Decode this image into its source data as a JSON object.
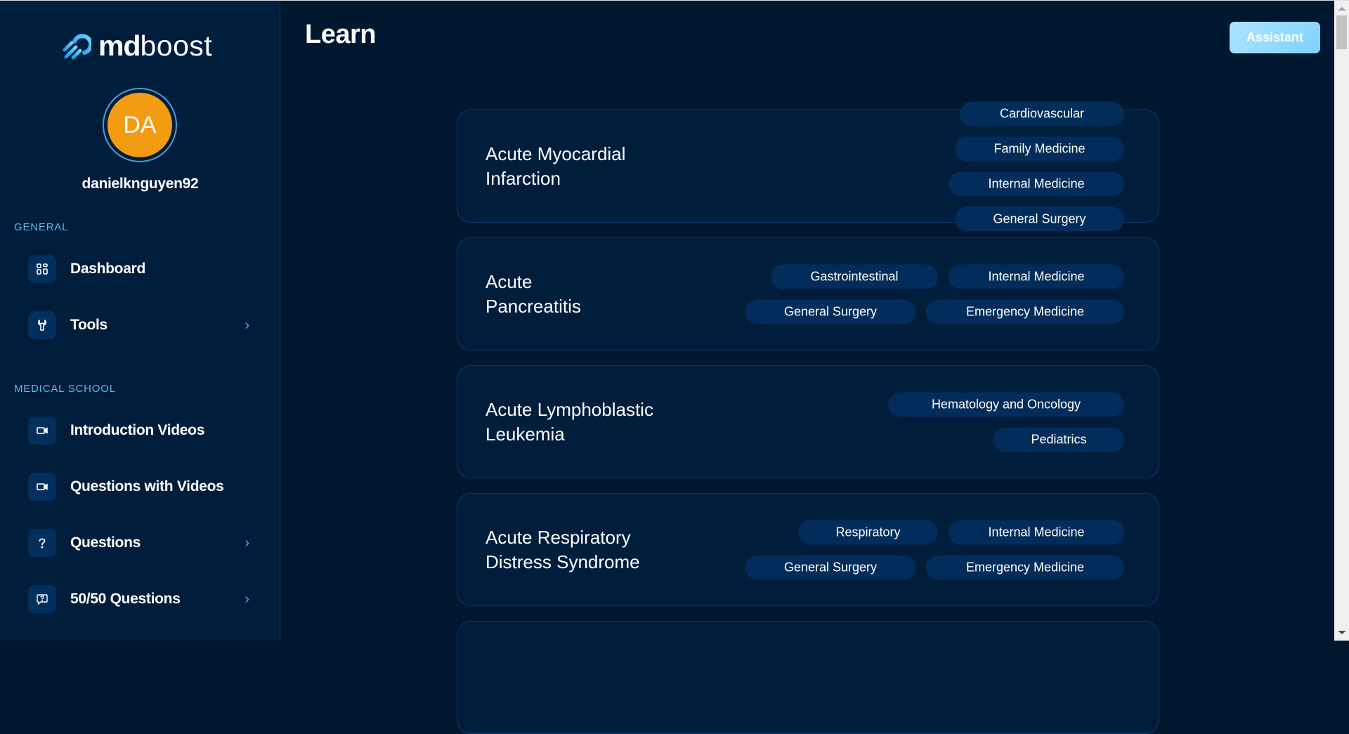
{
  "brand": {
    "name_bold": "md",
    "name_light": "boost"
  },
  "user": {
    "initials": "DA",
    "username": "danielknguyen92",
    "avatar_color": "#f39c12"
  },
  "sidebar": {
    "sections": [
      {
        "label": "GENERAL",
        "items": [
          {
            "label": "Dashboard",
            "icon": "dashboard-grid-icon",
            "has_chevron": false
          },
          {
            "label": "Tools",
            "icon": "wrench-icon",
            "has_chevron": true
          }
        ]
      },
      {
        "label": "MEDICAL SCHOOL",
        "items": [
          {
            "label": "Introduction Videos",
            "icon": "video-camera-icon",
            "has_chevron": false
          },
          {
            "label": "Questions with Videos",
            "icon": "video-camera-icon",
            "has_chevron": false
          },
          {
            "label": "Questions",
            "icon": "question-mark-icon",
            "has_chevron": true
          },
          {
            "label": "50/50 Questions",
            "icon": "question-chat-icon",
            "has_chevron": true
          }
        ]
      }
    ],
    "chevron_glyph": "›"
  },
  "header": {
    "title": "Learn",
    "assistant_label": "Assistant"
  },
  "topics": [
    {
      "title": "Acute Myocardial Infarction",
      "tags": [
        "Cardiovascular",
        "Family Medicine",
        "Internal Medicine",
        "General Surgery"
      ]
    },
    {
      "title": "Acute Pancreatitis",
      "tags": [
        "Gastrointestinal",
        "Internal Medicine",
        "General Surgery",
        "Emergency Medicine"
      ]
    },
    {
      "title": "Acute Lymphoblastic Leukemia",
      "tags": [
        "Hematology and Oncology",
        "Pediatrics"
      ]
    },
    {
      "title": "Acute Respiratory Distress Syndrome",
      "tags": [
        "Respiratory",
        "Internal Medicine",
        "General Surgery",
        "Emergency Medicine"
      ]
    },
    {
      "title": "",
      "tags": []
    }
  ],
  "colors": {
    "sidebar_bg": "#001d3c",
    "main_bg": "#001730",
    "accent": "#5cb8f2",
    "tag_bg": "#022d5a",
    "assistant_gradient": [
      "#aee3ff",
      "#7dd2ff"
    ]
  }
}
